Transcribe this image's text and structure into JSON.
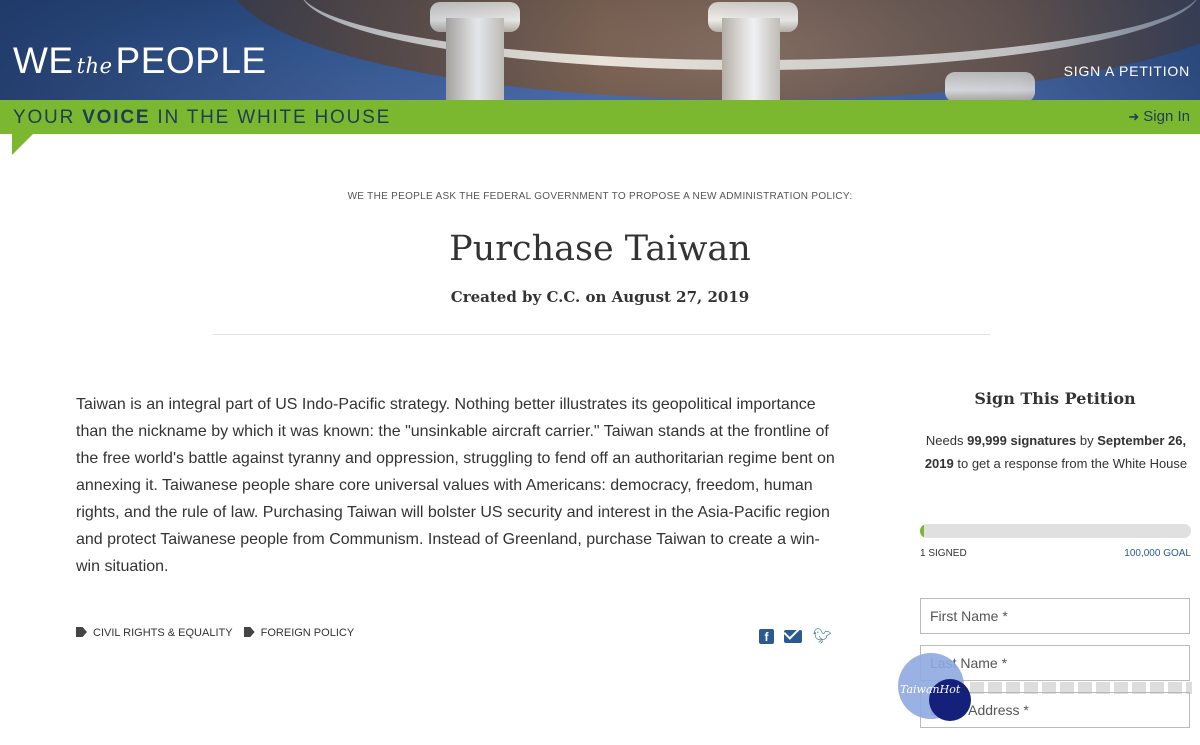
{
  "header": {
    "logo": {
      "we": "WE",
      "the": "the",
      "people": "PEOPLE"
    },
    "sign_petition_link": "SIGN A PETITION",
    "tagline": {
      "pre": "YOUR ",
      "bold": "VOICE",
      "post": " IN THE WHITE HOUSE"
    },
    "sign_in": "Sign In"
  },
  "petition": {
    "ask": "WE THE PEOPLE ASK THE FEDERAL GOVERNMENT TO PROPOSE A NEW ADMINISTRATION POLICY:",
    "title": "Purchase Taiwan",
    "created": "Created by C.C. on August 27, 2019",
    "body": "Taiwan is an integral part of US Indo-Pacific strategy. Nothing better illustrates its geopolitical importance than the nickname by which it was known: the \"unsinkable aircraft carrier.\" Taiwan stands at the frontline of the free world's battle against tyranny and oppression, struggling to fend off an authoritarian regime bent on annexing it. Taiwanese people share core universal values with Americans: democracy, freedom, human rights, and the rule of law. Purchasing Taiwan will bolster US security and interest in the Asia-Pacific region and protect Taiwanese people from Communism. Instead of Greenland, purchase Taiwan to create a win-win situation.",
    "tags": [
      "CIVIL RIGHTS & EQUALITY",
      "FOREIGN POLICY"
    ],
    "share_icons": [
      "facebook-icon",
      "email-icon",
      "twitter-icon"
    ]
  },
  "sidebar": {
    "title": "Sign This Petition",
    "needs": {
      "p1": "Needs ",
      "count": "99,999 signatures",
      "p2": " by ",
      "date": "September 26, 2019",
      "p3": " to get a response from the White House"
    },
    "progress_fraction": 1e-05,
    "signed_label": "1 SIGNED",
    "goal_label": "100,000 GOAL",
    "fields": {
      "first_name": "First Name *",
      "last_name": "Last Name *",
      "email": "Email Address *"
    }
  },
  "watermark": {
    "text": "TaiwanHot"
  },
  "colors": {
    "green": "#7cb82f",
    "navy": "#1f3b57",
    "link": "#2a5a8f"
  }
}
